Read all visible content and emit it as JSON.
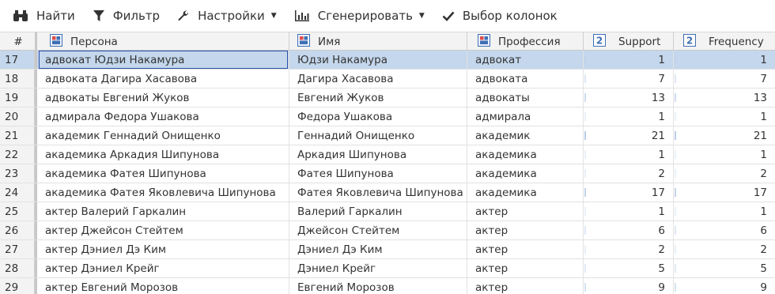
{
  "toolbar": {
    "find_label": "Найти",
    "filter_label": "Фильтр",
    "settings_label": "Настройки",
    "generate_label": "Сгенерировать",
    "columns_label": "Выбор колонок",
    "icons": [
      "binoculars-icon",
      "funnel-icon",
      "wrench-icon",
      "bar-chart-icon",
      "checkmark-icon"
    ]
  },
  "grid": {
    "headers": {
      "rownum": "#",
      "persona": "Персона",
      "name": "Имя",
      "profession": "Профессия",
      "support": "Support",
      "frequency": "Frequency"
    },
    "rows": [
      {
        "n": "17",
        "persona": "адвокат Юдзи Накамура",
        "name": "Юдзи Накамура",
        "profession": "адвокат",
        "support": "1",
        "frequency": "1",
        "support_level": 0.05,
        "frequency_level": 0.05
      },
      {
        "n": "18",
        "persona": "адвоката Дагира Хасавова",
        "name": "Дагира Хасавова",
        "profession": "адвоката",
        "support": "7",
        "frequency": "7",
        "support_level": 0.3,
        "frequency_level": 0.3
      },
      {
        "n": "19",
        "persona": "адвокаты Евгений Жуков",
        "name": "Евгений Жуков",
        "profession": "адвокаты",
        "support": "13",
        "frequency": "13",
        "support_level": 0.6,
        "frequency_level": 0.6
      },
      {
        "n": "20",
        "persona": "адмирала Федора Ушакова",
        "name": "Федора Ушакова",
        "profession": "адмирала",
        "support": "1",
        "frequency": "1",
        "support_level": 0.05,
        "frequency_level": 0.05
      },
      {
        "n": "21",
        "persona": "академик Геннадий Онищенко",
        "name": "Геннадий Онищенко",
        "profession": "академик",
        "support": "21",
        "frequency": "21",
        "support_level": 1.0,
        "frequency_level": 1.0
      },
      {
        "n": "22",
        "persona": "академика Аркадия Шипунова",
        "name": "Аркадия Шипунова",
        "profession": "академика",
        "support": "1",
        "frequency": "1",
        "support_level": 0.05,
        "frequency_level": 0.05
      },
      {
        "n": "23",
        "persona": "академика Фатея Шипунова",
        "name": "Фатея Шипунова",
        "profession": "академика",
        "support": "2",
        "frequency": "2",
        "support_level": 0.1,
        "frequency_level": 0.1
      },
      {
        "n": "24",
        "persona": "академика Фатея Яковлевича Шипунова",
        "name": "Фатея Яковлевича Шипунова",
        "profession": "академика",
        "support": "17",
        "frequency": "17",
        "support_level": 0.8,
        "frequency_level": 0.8
      },
      {
        "n": "25",
        "persona": "актер Валерий Гаркалин",
        "name": "Валерий Гаркалин",
        "profession": "актер",
        "support": "1",
        "frequency": "1",
        "support_level": 0.05,
        "frequency_level": 0.05
      },
      {
        "n": "26",
        "persona": "актер Джейсон Стейтем",
        "name": "Джейсон Стейтем",
        "profession": "актер",
        "support": "6",
        "frequency": "6",
        "support_level": 0.28,
        "frequency_level": 0.28
      },
      {
        "n": "27",
        "persona": "актер Дэниел Дэ Ким",
        "name": "Дэниел Дэ Ким",
        "profession": "актер",
        "support": "2",
        "frequency": "2",
        "support_level": 0.1,
        "frequency_level": 0.1
      },
      {
        "n": "28",
        "persona": "актер Дэниел Крейг",
        "name": "Дэниел Крейг",
        "profession": "актер",
        "support": "5",
        "frequency": "5",
        "support_level": 0.24,
        "frequency_level": 0.24
      },
      {
        "n": "29",
        "persona": "актер Евгений Морозов",
        "name": "Евгений Морозов",
        "profession": "актер",
        "support": "9",
        "frequency": "9",
        "support_level": 0.43,
        "frequency_level": 0.43
      }
    ]
  },
  "colors": {
    "selected_row": "#c4d7ec",
    "focus_border": "#2d4fa8",
    "header_bg": "#f3f3f3"
  }
}
